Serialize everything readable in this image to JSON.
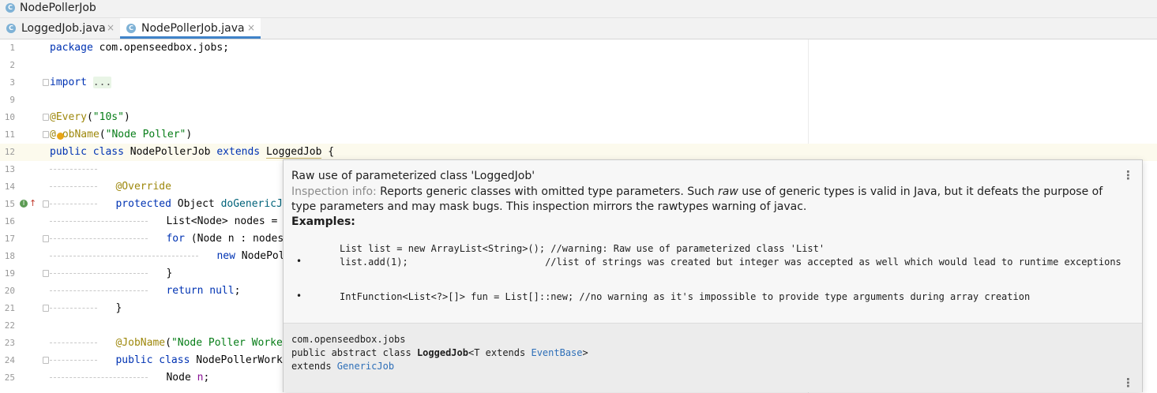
{
  "breadcrumb": {
    "label": "NodePollerJob",
    "icon": "class-icon"
  },
  "tabs": [
    {
      "label": "LoggedJob.java",
      "active": false
    },
    {
      "label": "NodePollerJob.java",
      "active": true
    }
  ],
  "tab_close_glyph": "×",
  "class_icon_letter": "C",
  "colors": {
    "keyword": "#0033b3",
    "annotation": "#9e880d",
    "string": "#067d17",
    "accent": "#4083c9",
    "current_line": "#fcfaed"
  },
  "code": {
    "line_numbers": [
      "1",
      "2",
      "3",
      "9",
      "10",
      "11",
      "12",
      "13",
      "14",
      "15",
      "16",
      "17",
      "18",
      "19",
      "20",
      "21",
      "22",
      "23",
      "24",
      "25"
    ],
    "l1_kw": "package",
    "l1_rest": " com.openseedbox.jobs;",
    "l3_kw": "import",
    "l3_folded": "...",
    "l10_ann": "@Every",
    "l10_p1": "(",
    "l10_str": "\"10s\"",
    "l10_p2": ")",
    "l11_ann_a": "@",
    "l11_ann_b": "obName",
    "l11_p1": "(",
    "l11_str": "\"Node Poller\"",
    "l11_p2": ")",
    "l12_kw1": "public",
    "l12_kw2": "class",
    "l12_name": "NodePollerJob",
    "l12_kw3": "extends",
    "l12_super": "LoggedJob",
    "l12_brace": " {",
    "l14_ann": "@Override",
    "l15_kw": "protected",
    "l15_rest": " Object ",
    "l15_fn": "doGenericJob",
    "l16_text": "List<Node> nodes = No",
    "l17_kw": "for",
    "l17_rest": " (Node n : nodes) ",
    "l18_kw": "new",
    "l18_rest": " NodePolle",
    "l19_text": "}",
    "l20_kw": "return",
    "l20_kw2": "null",
    "l20_rest": ";",
    "l21_text": "}",
    "l23_ann": "@JobName",
    "l23_p1": "(",
    "l23_str": "\"Node Poller Worker\"",
    "l24_kw1": "public",
    "l24_kw2": "class",
    "l24_rest": " NodePollerWorker",
    "l25_text": "Node ",
    "l25_fld": "n",
    "l25_end": ";"
  },
  "popup": {
    "title": "Raw use of parameterized class 'LoggedJob'",
    "info_label": "Inspection info:",
    "desc_1": " Reports generic classes with omitted type parameters. Such ",
    "desc_raw": "raw",
    "desc_2": " use of generic types is valid in Java, but it defeats the purpose of type parameters and may mask bugs. This inspection mirrors the ",
    "desc_rawtypes": "rawtypes",
    "desc_3": " warning of ",
    "desc_javac": "javac",
    "desc_4": ".",
    "examples_label": "Examples:",
    "example1_line1": "List list = new ArrayList<String>(); //warning: Raw use of parameterized class 'List'",
    "example1_line2": "list.add(1);                        //list of strings was created but integer was accepted as well which would lead to runtime exceptions",
    "example2_line1": "IntFunction<List<?>[]> fun = List[]::new; //no warning as it's impossible to provide type arguments during array creation",
    "bullet": "•",
    "menu_glyph": "⋮",
    "footer_package": "com.openseedbox.jobs",
    "footer_decl_a": "public abstract class ",
    "footer_decl_name": "LoggedJob",
    "footer_decl_b": "<T extends ",
    "footer_decl_link": "EventBase",
    "footer_decl_c": ">",
    "footer_extends": "extends ",
    "footer_extends_link": "GenericJob"
  }
}
